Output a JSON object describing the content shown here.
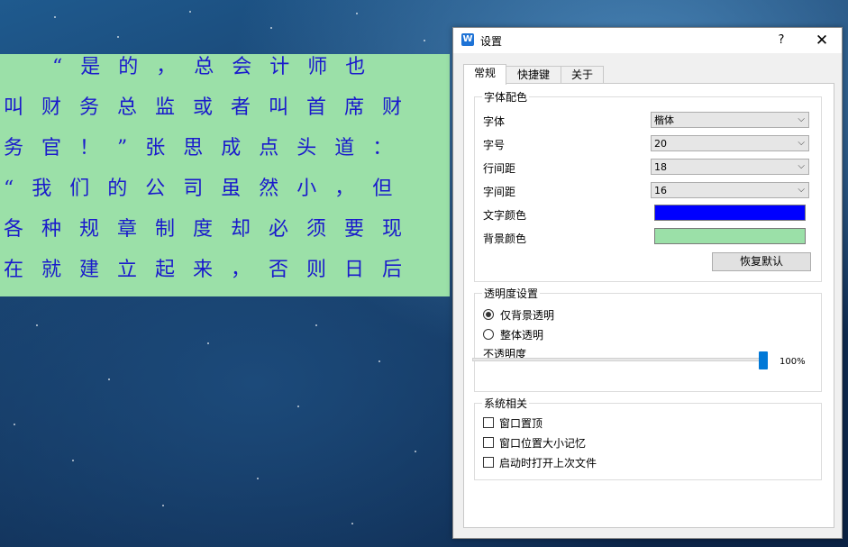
{
  "reader": {
    "lines": [
      "  “是的，总会计师也",
      "叫财务总监或者叫首席财",
      "务官！”张思成点头道：",
      "“我们的公司虽然小，但",
      "各种规章制度却必须要现",
      "在就建立起来，否则日后"
    ],
    "text_color": "#1a1acc",
    "bg_color": "#9be0a8"
  },
  "dialog": {
    "title": "设置",
    "help_label": "?",
    "close_label": "✕",
    "icon_name": "app-logo-icon",
    "tabs": [
      {
        "label": "常规",
        "active": true
      },
      {
        "label": "快捷键",
        "active": false
      },
      {
        "label": "关于",
        "active": false
      }
    ]
  },
  "font_group": {
    "title": "字体配色",
    "font_label": "字体",
    "font_value": "楷体",
    "size_label": "字号",
    "size_value": "20",
    "line_spacing_label": "行间距",
    "line_spacing_value": "18",
    "char_spacing_label": "字间距",
    "char_spacing_value": "16",
    "text_color_label": "文字颜色",
    "text_color": "#0000ff",
    "bg_color_label": "背景颜色",
    "bg_color": "#9be0a8",
    "reset_label": "恢复默认"
  },
  "transparency_group": {
    "title": "透明度设置",
    "option_bg_only": "仅背景透明",
    "option_whole": "整体透明",
    "selected": "仅背景透明",
    "opacity_label": "不透明度",
    "opacity_value": 100,
    "opacity_text": "100%"
  },
  "system_group": {
    "title": "系统相关",
    "stay_on_top": "窗口置顶",
    "remember_geometry": "窗口位置大小记忆",
    "open_last_file": "启动时打开上次文件"
  }
}
